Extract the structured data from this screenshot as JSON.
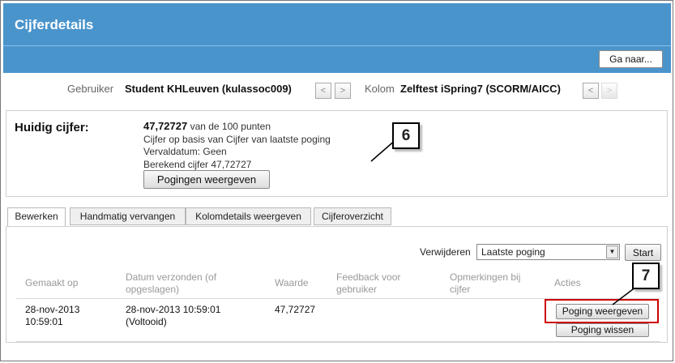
{
  "header": {
    "title": "Cijferdetails",
    "goto_label": "Ga naar..."
  },
  "nav": {
    "user_label": "Gebruiker",
    "user_value": "Student KHLeuven (kulassoc009)",
    "column_label": "Kolom",
    "column_value": "Zelftest iSpring7 (SCORM/AICC)",
    "prev_glyph": "<",
    "next_glyph": ">"
  },
  "grade": {
    "heading": "Huidig cijfer:",
    "score": "47,72727",
    "score_suffix": " van de 100 punten",
    "basis": "Cijfer op basis van Cijfer van laatste poging",
    "due": "Vervaldatum: Geen",
    "calculated": "Berekend cijfer  47,72727",
    "attempts_button": "Pogingen weergeven"
  },
  "tabs": [
    {
      "label": "Bewerken"
    },
    {
      "label": "Handmatig vervangen"
    },
    {
      "label": "Kolomdetails weergeven"
    },
    {
      "label": "Cijferoverzicht"
    }
  ],
  "controls": {
    "delete_label": "Verwijderen",
    "delete_selected": "Laatste poging",
    "start_button": "Start"
  },
  "table": {
    "headers": [
      "Gemaakt op",
      "Datum verzonden (of opgeslagen)",
      "Waarde",
      "Feedback voor gebruiker",
      "Opmerkingen bij cijfer",
      "Acties"
    ],
    "rows": [
      {
        "made_on": "28-nov-2013 10:59:01",
        "submitted": "28-nov-2013 10:59:01 (Voltooid)",
        "value": "47,72727",
        "feedback": "",
        "notes": "",
        "view_button": "Poging weergeven",
        "clear_button": "Poging wissen"
      }
    ]
  },
  "callouts": {
    "c6": "6",
    "c7": "7"
  }
}
